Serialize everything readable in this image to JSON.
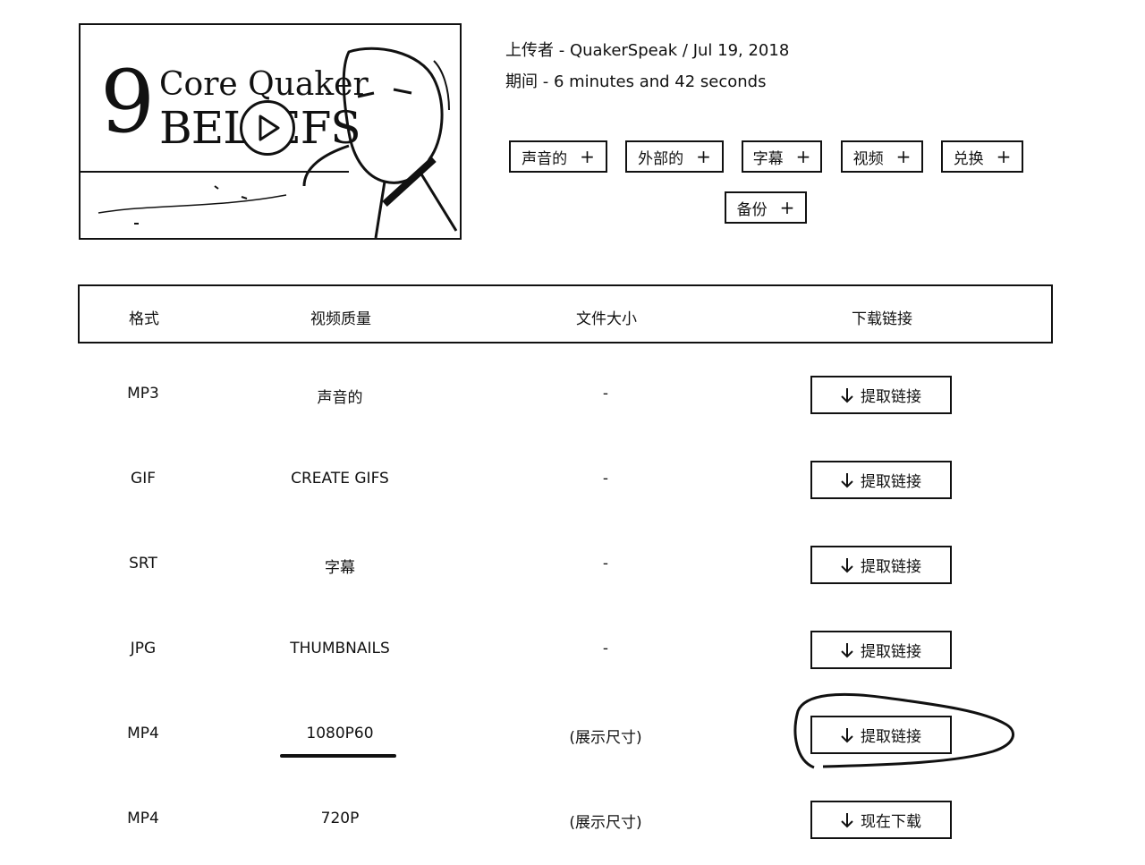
{
  "thumbnail": {
    "number": "9",
    "line1": "Core Quaker",
    "line2": "BELIEFS"
  },
  "meta": {
    "uploader": "上传者 - QuakerSpeak / Jul 19, 2018",
    "duration": "期间 -  6 minutes and 42 seconds"
  },
  "options": [
    {
      "label": "声音的",
      "icon": "plus-icon"
    },
    {
      "label": "外部的",
      "icon": "plus-icon"
    },
    {
      "label": "字幕",
      "icon": "plus-icon"
    },
    {
      "label": "视频",
      "icon": "plus-icon"
    },
    {
      "label": "兑换",
      "icon": "plus-icon"
    },
    {
      "label": "备份",
      "icon": "plus-icon"
    }
  ],
  "plus_symbol": "+",
  "table": {
    "headers": [
      "格式",
      "视频质量",
      "文件大小",
      "下载链接"
    ],
    "rows": [
      {
        "format": "MP3",
        "quality": "声音的",
        "size": "-",
        "action": "提取链接"
      },
      {
        "format": "GIF",
        "quality": "CREATE GIFS",
        "size": "-",
        "action": "提取链接"
      },
      {
        "format": "SRT",
        "quality": "字幕",
        "size": "-",
        "action": "提取链接"
      },
      {
        "format": "JPG",
        "quality": "THUMBNAILS",
        "size": "-",
        "action": "提取链接"
      },
      {
        "format": "MP4",
        "quality": "1080P60",
        "size": "(展示尺寸)",
        "action": "提取链接"
      },
      {
        "format": "MP4",
        "quality": "720P",
        "size": "(展示尺寸)",
        "action": "现在下载"
      }
    ]
  },
  "icons": {
    "download": "arrow-down-icon",
    "play": "play-icon"
  }
}
